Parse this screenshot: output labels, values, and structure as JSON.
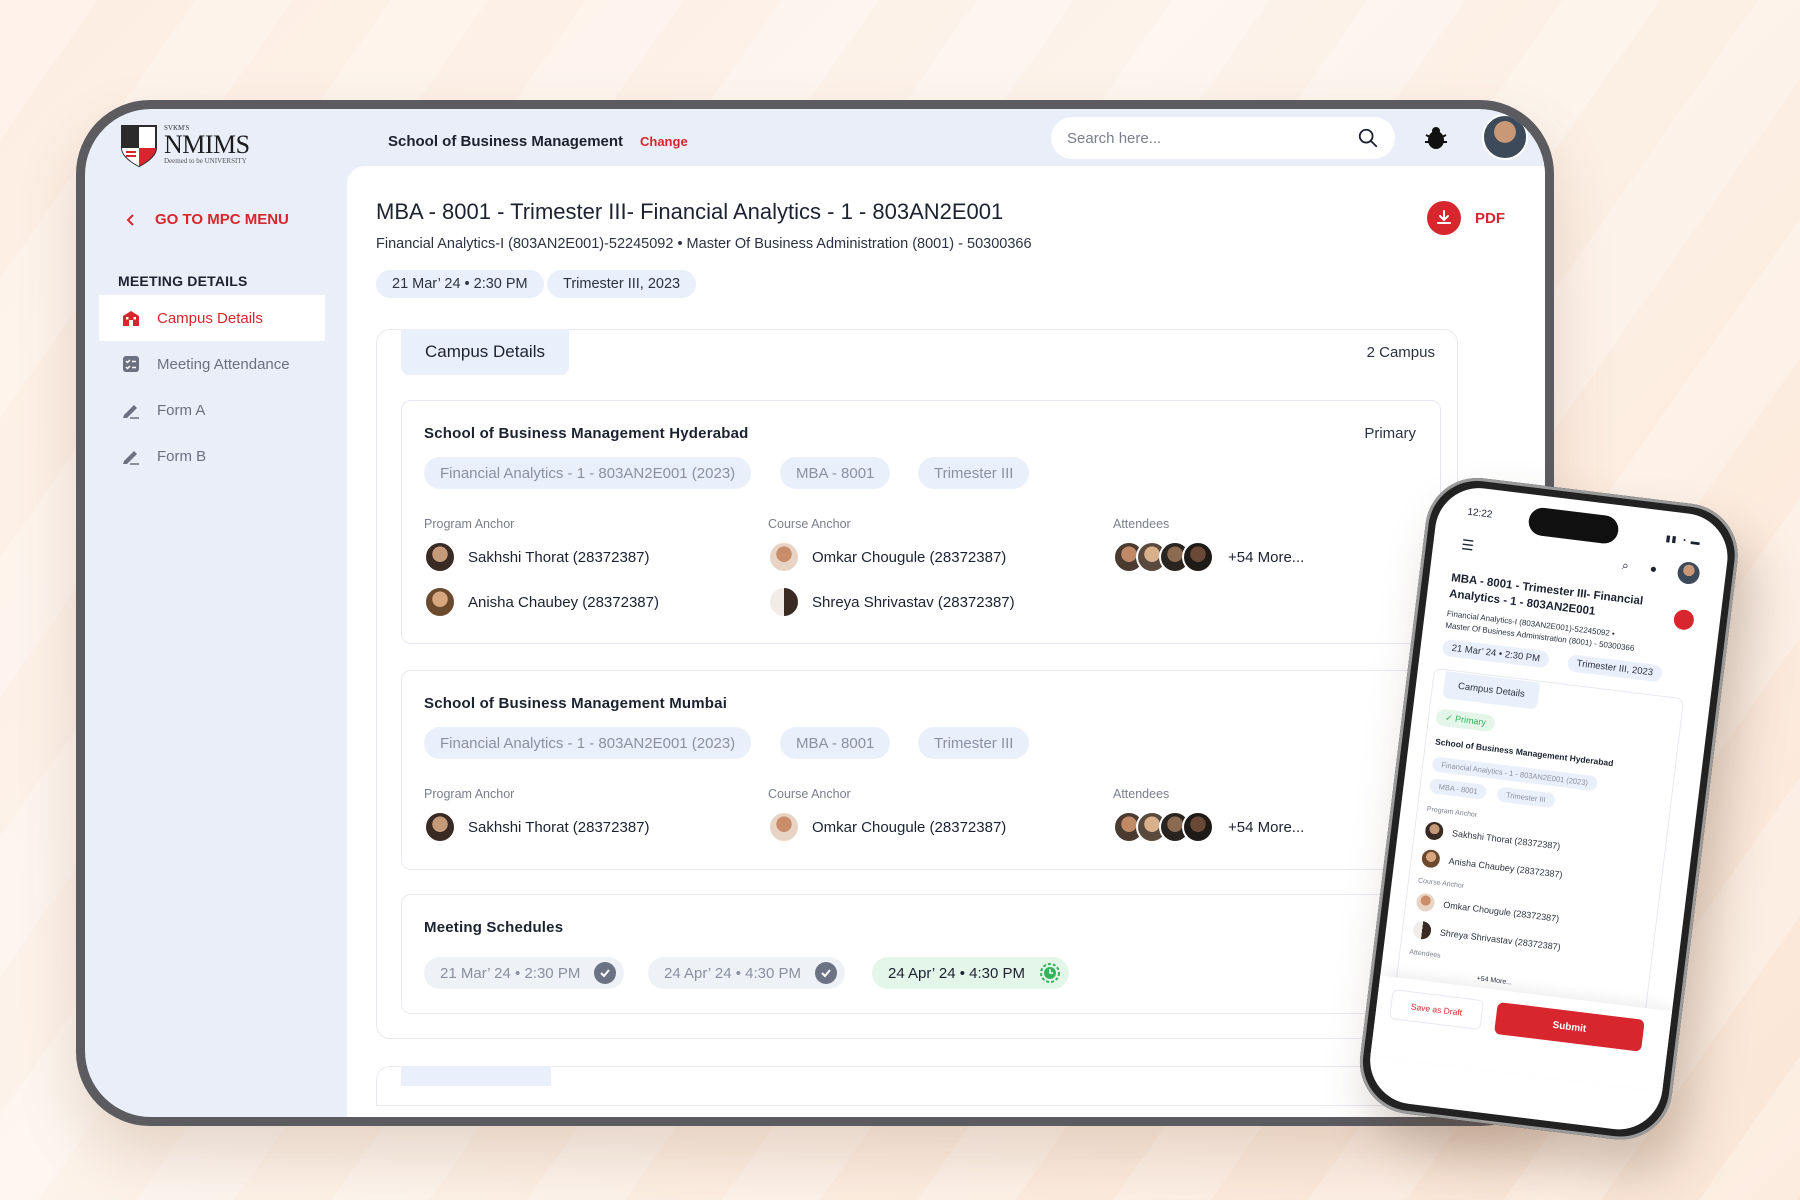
{
  "header": {
    "logo_small": "SVKM'S",
    "logo_main": "NMIMS",
    "logo_sub": "Deemed to be UNIVERSITY",
    "school": "School of Business Management",
    "change": "Change",
    "search_placeholder": "Search here..."
  },
  "sidebar": {
    "back": "GO TO MPC MENU",
    "section": "MEETING DETAILS",
    "items": [
      {
        "label": "Campus Details",
        "icon": "building-icon"
      },
      {
        "label": "Meeting Attendance",
        "icon": "checklist-icon"
      },
      {
        "label": "Form A",
        "icon": "pen-icon"
      },
      {
        "label": "Form B",
        "icon": "pen-icon"
      }
    ]
  },
  "main": {
    "title": "MBA - 8001 - Trimester III- Financial Analytics - 1 - 803AN2E001",
    "subtitle": "Financial Analytics-I (803AN2E001)-52245092  •  Master Of Business Administration (8001) - 50300366",
    "chip_date": "21 Mar’ 24  •  2:30 PM",
    "chip_term": "Trimester III, 2023",
    "pdf": "PDF",
    "tab": "Campus Details",
    "count": "2 Campus",
    "campuses": [
      {
        "name": "School of Business Management Hyderabad",
        "badge": "Primary",
        "tags": [
          "Financial Analytics - 1 - 803AN2E001 (2023)",
          "MBA - 8001",
          "Trimester III"
        ],
        "program_label": "Program Anchor",
        "course_label": "Course Anchor",
        "attendees_label": "Attendees",
        "program": [
          "Sakhshi Thorat (28372387)",
          "Anisha Chaubey (28372387)"
        ],
        "course": [
          "Omkar Chougule (28372387)",
          "Shreya Shrivastav (28372387)"
        ],
        "more": "+54 More..."
      },
      {
        "name": "School of Business Management Mumbai",
        "tags": [
          "Financial Analytics - 1 - 803AN2E001 (2023)",
          "MBA - 8001",
          "Trimester III"
        ],
        "program_label": "Program Anchor",
        "course_label": "Course Anchor",
        "attendees_label": "Attendees",
        "program": [
          "Sakhshi Thorat (28372387)"
        ],
        "course": [
          "Omkar Chougule (28372387)"
        ],
        "more": "+54 More..."
      }
    ],
    "schedules_title": "Meeting Schedules",
    "schedules": [
      {
        "label": "21 Mar’ 24  •  2:30 PM",
        "status": "done"
      },
      {
        "label": "24 Apr’ 24  •  4:30 PM",
        "status": "done"
      },
      {
        "label": "24 Apr’ 24  •  4:30 PM",
        "status": "current"
      }
    ]
  },
  "phone": {
    "time": "12:22",
    "title": "MBA - 8001 - Trimester III- Financial Analytics - 1 - 803AN2E001",
    "sub1": "Financial Analytics-I (803AN2E001)-52245092  •",
    "sub2": "Master Of Business Administration (8001) - 50300366",
    "chip_date": "21 Mar’ 24  •  2:30 PM",
    "chip_term": "Trimester III, 2023",
    "tab": "Campus Details",
    "primary": "Primary",
    "campus": "School of Business Management Hyderabad",
    "tags": [
      "Financial Analytics - 1 - 803AN2E001 (2023)",
      "MBA - 8001",
      "Trimester III"
    ],
    "program_label": "Program Anchor",
    "program": [
      "Sakhshi Thorat (28372387)",
      "Anisha Chaubey (28372387)"
    ],
    "course_label": "Course Anchor",
    "course": [
      "Omkar Chougule (28372387)",
      "Shreya Shrivastav (28372387)"
    ],
    "attendees_label": "Attendees",
    "more": "+54 More...",
    "save": "Save as Draft",
    "submit": "Submit"
  },
  "colors": {
    "accent": "#d7262e",
    "chip": "#eaf0fb",
    "success": "#34b35a"
  }
}
